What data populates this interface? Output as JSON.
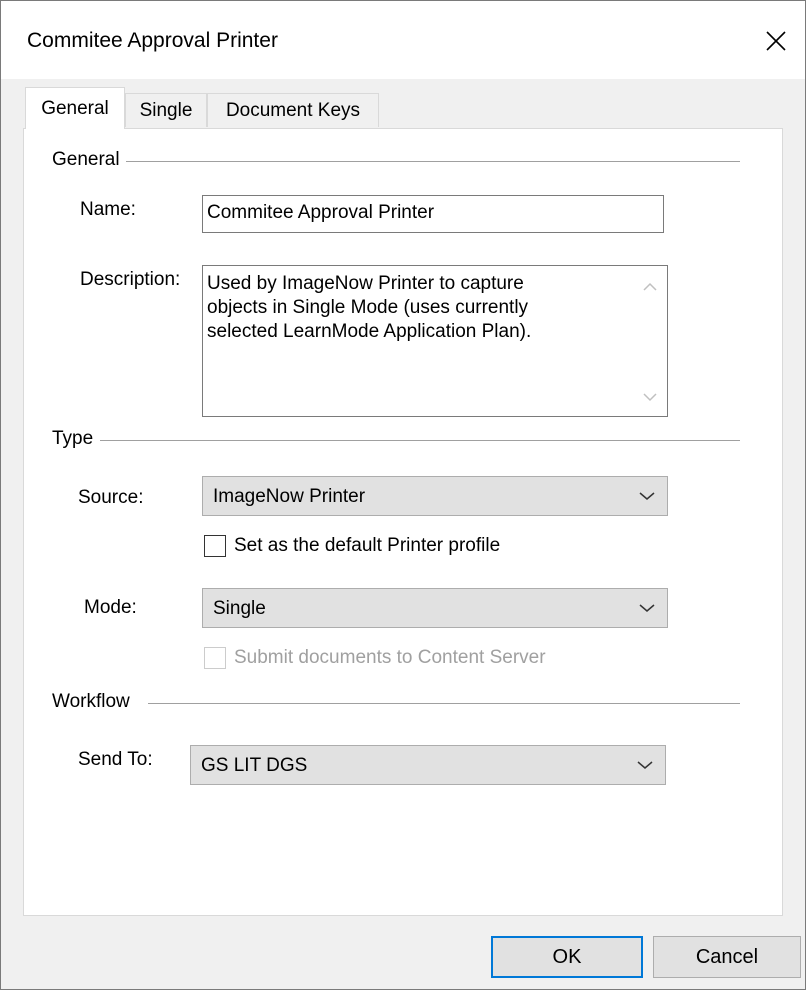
{
  "window": {
    "title": "Commitee Approval Printer",
    "close_icon": "close-icon"
  },
  "tabs": [
    {
      "label": "General",
      "active": true
    },
    {
      "label": "Single",
      "active": false
    },
    {
      "label": "Document Keys",
      "active": false
    }
  ],
  "general": {
    "group_title": "General",
    "name_label": "Name:",
    "name_value": "Commitee Approval Printer",
    "description_label": "Description:",
    "description_lines": [
      "Used by ImageNow Printer to capture",
      "objects in Single Mode (uses currently",
      "selected LearnMode Application Plan)."
    ]
  },
  "type": {
    "group_title": "Type",
    "source_label": "Source:",
    "source_value": "ImageNow Printer",
    "default_checkbox_label": "Set as the default Printer profile",
    "default_checked": false,
    "mode_label": "Mode:",
    "mode_value": "Single",
    "submit_checkbox_label": "Submit documents to Content Server",
    "submit_checked": false,
    "submit_enabled": false
  },
  "workflow": {
    "group_title": "Workflow",
    "send_to_label": "Send To:",
    "send_to_value": "GS LIT DGS"
  },
  "buttons": {
    "ok": "OK",
    "cancel": "Cancel"
  },
  "colors": {
    "default_button_border": "#0078d7",
    "dialog_background": "#f0f0f0",
    "disabled_text": "#a0a0a0"
  }
}
